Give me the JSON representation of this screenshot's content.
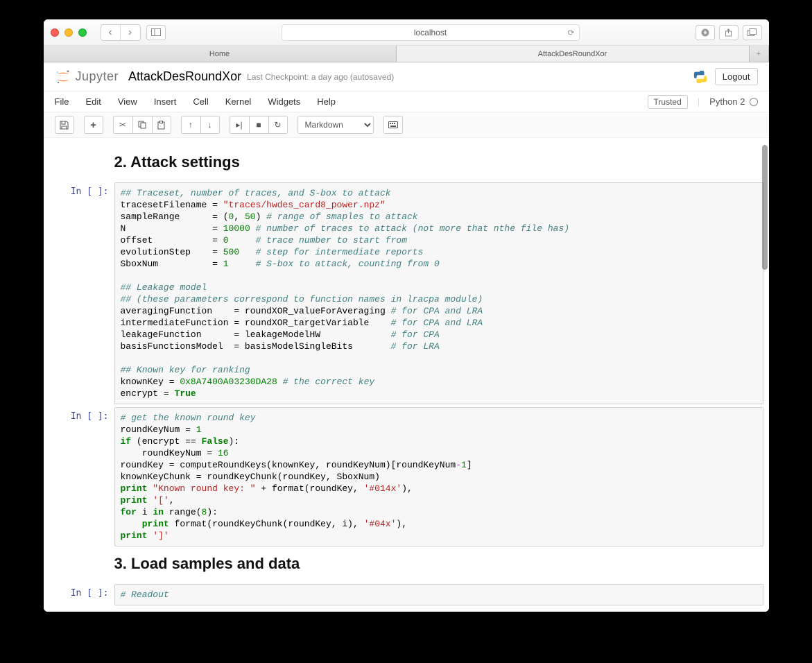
{
  "browser": {
    "address": "localhost",
    "tabs": [
      "Home",
      "AttackDesRoundXor"
    ],
    "plus": "+"
  },
  "header": {
    "logo": "Jupyter",
    "title": "AttackDesRoundXor",
    "checkpoint": "Last Checkpoint: a day ago (autosaved)",
    "logout": "Logout"
  },
  "menu": {
    "items": [
      "File",
      "Edit",
      "View",
      "Insert",
      "Cell",
      "Kernel",
      "Widgets",
      "Help"
    ],
    "trusted": "Trusted",
    "kernel": "Python 2"
  },
  "toolbar": {
    "celltype": "Markdown"
  },
  "cells": {
    "h2a": "2. Attack settings",
    "h2b": "3. Load samples and data",
    "prompt1": "In [ ]:",
    "prompt2": "In [ ]:",
    "prompt3": "In [ ]:",
    "code1": {
      "c1": "## Traceset, number of traces, and S-box to attack",
      "l2a": "tracesetFilename = ",
      "l2s": "\"traces/hwdes_card8_power.npz\"",
      "l3a": "sampleRange      = (",
      "l3n1": "0",
      "l3b": ", ",
      "l3n2": "50",
      "l3c": ") ",
      "l3d": "# range of smaples to attack",
      "l4a": "N                = ",
      "l4n": "10000",
      "l4c": " # number of traces to attack (not more that nthe file has)",
      "l5a": "offset           = ",
      "l5n": "0",
      "l5c": "     # trace number to start from",
      "l6a": "evolutionStep    = ",
      "l6n": "500",
      "l6c": "   # step for intermediate reports",
      "l7a": "SboxNum          = ",
      "l7n": "1",
      "l7c": "     # S-box to attack, counting from 0",
      "c2": "## Leakage model",
      "c3": "## (these parameters correspond to function names in lracpa module)",
      "l8": "averagingFunction    = roundXOR_valueForAveraging ",
      "l8c": "# for CPA and LRA",
      "l9": "intermediateFunction = roundXOR_targetVariable    ",
      "l9c": "# for CPA and LRA",
      "l10": "leakageFunction      = leakageModelHW             ",
      "l10c": "# for CPA",
      "l11": "basisFunctionsModel  = basisModelSingleBits       ",
      "l11c": "# for LRA",
      "c4": "## Known key for ranking",
      "l12a": "knownKey = ",
      "l12n": "0x8A7400A03230DA28",
      "l12c": " # the correct key",
      "l13a": "encrypt = ",
      "l13k": "True"
    },
    "code2": {
      "c1": "# get the known round key",
      "l2a": "roundKeyNum = ",
      "l2n": "1",
      "l3a": "if",
      "l3b": " (encrypt == ",
      "l3k": "False",
      "l3c": "):",
      "l4a": "    roundKeyNum = ",
      "l4n": "16",
      "l5a": "roundKey = computeRoundKeys(knownKey, roundKeyNum)[roundKeyNum",
      "l5o": "-",
      "l5n": "1",
      "l5b": "]",
      "l6": "knownKeyChunk = roundKeyChunk(roundKey, SboxNum)",
      "l7a": "print",
      "l7s": " \"Known round key: \"",
      "l7b": " + format(roundKey, ",
      "l7s2": "'#014x'",
      "l7c": "),",
      "l8a": "print",
      "l8s": " '['",
      "l8b": ",",
      "l9a": "for",
      "l9b": " i ",
      "l9c": "in",
      "l9d": " range(",
      "l9n": "8",
      "l9e": "):",
      "l10a": "    ",
      "l10p": "print",
      "l10b": " format(roundKeyChunk(roundKey, i), ",
      "l10s": "'#04x'",
      "l10c": "),",
      "l11a": "print",
      "l11s": " ']'"
    },
    "code3": {
      "c1": "# Readout"
    }
  }
}
